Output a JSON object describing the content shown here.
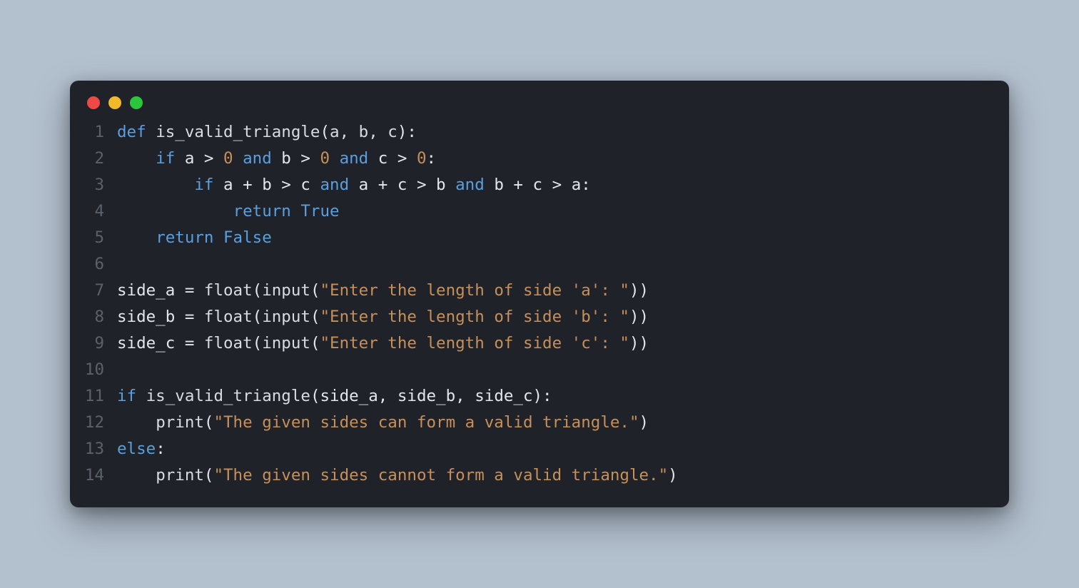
{
  "window": {
    "dots": {
      "red": "#ed4947",
      "yellow": "#f2b92c",
      "green": "#2bc63e"
    }
  },
  "code": {
    "lines": [
      {
        "n": "1",
        "tokens": [
          {
            "t": "def ",
            "c": "kw"
          },
          {
            "t": "is_valid_triangle",
            "c": "fn"
          },
          {
            "t": "(",
            "c": "op"
          },
          {
            "t": "a, b, c",
            "c": "param"
          },
          {
            "t": ")",
            "c": "op"
          },
          {
            "t": ":",
            "c": "op"
          }
        ]
      },
      {
        "n": "2",
        "tokens": [
          {
            "t": "    ",
            "c": "code"
          },
          {
            "t": "if ",
            "c": "kw"
          },
          {
            "t": "a ",
            "c": "id"
          },
          {
            "t": "> ",
            "c": "op"
          },
          {
            "t": "0",
            "c": "num"
          },
          {
            "t": " and ",
            "c": "kw"
          },
          {
            "t": "b ",
            "c": "id"
          },
          {
            "t": "> ",
            "c": "op"
          },
          {
            "t": "0",
            "c": "num"
          },
          {
            "t": " and ",
            "c": "kw"
          },
          {
            "t": "c ",
            "c": "id"
          },
          {
            "t": "> ",
            "c": "op"
          },
          {
            "t": "0",
            "c": "num"
          },
          {
            "t": ":",
            "c": "op"
          }
        ]
      },
      {
        "n": "3",
        "tokens": [
          {
            "t": "        ",
            "c": "code"
          },
          {
            "t": "if ",
            "c": "kw"
          },
          {
            "t": "a ",
            "c": "id"
          },
          {
            "t": "+ ",
            "c": "op"
          },
          {
            "t": "b ",
            "c": "id"
          },
          {
            "t": "> ",
            "c": "op"
          },
          {
            "t": "c ",
            "c": "id"
          },
          {
            "t": "and ",
            "c": "kw"
          },
          {
            "t": "a ",
            "c": "id"
          },
          {
            "t": "+ ",
            "c": "op"
          },
          {
            "t": "c ",
            "c": "id"
          },
          {
            "t": "> ",
            "c": "op"
          },
          {
            "t": "b ",
            "c": "id"
          },
          {
            "t": "and ",
            "c": "kw"
          },
          {
            "t": "b ",
            "c": "id"
          },
          {
            "t": "+ ",
            "c": "op"
          },
          {
            "t": "c ",
            "c": "id"
          },
          {
            "t": "> ",
            "c": "op"
          },
          {
            "t": "a",
            "c": "id"
          },
          {
            "t": ":",
            "c": "op"
          }
        ]
      },
      {
        "n": "4",
        "tokens": [
          {
            "t": "            ",
            "c": "code"
          },
          {
            "t": "return ",
            "c": "kw"
          },
          {
            "t": "True",
            "c": "bool"
          }
        ]
      },
      {
        "n": "5",
        "tokens": [
          {
            "t": "    ",
            "c": "code"
          },
          {
            "t": "return ",
            "c": "kw"
          },
          {
            "t": "False",
            "c": "bool"
          }
        ]
      },
      {
        "n": "6",
        "tokens": [
          {
            "t": "",
            "c": "code"
          }
        ]
      },
      {
        "n": "7",
        "tokens": [
          {
            "t": "side_a ",
            "c": "id"
          },
          {
            "t": "= ",
            "c": "op"
          },
          {
            "t": "float",
            "c": "call"
          },
          {
            "t": "(",
            "c": "op"
          },
          {
            "t": "input",
            "c": "call"
          },
          {
            "t": "(",
            "c": "op"
          },
          {
            "t": "\"Enter the length of side 'a': \"",
            "c": "str"
          },
          {
            "t": "))",
            "c": "op"
          }
        ]
      },
      {
        "n": "8",
        "tokens": [
          {
            "t": "side_b ",
            "c": "id"
          },
          {
            "t": "= ",
            "c": "op"
          },
          {
            "t": "float",
            "c": "call"
          },
          {
            "t": "(",
            "c": "op"
          },
          {
            "t": "input",
            "c": "call"
          },
          {
            "t": "(",
            "c": "op"
          },
          {
            "t": "\"Enter the length of side 'b': \"",
            "c": "str"
          },
          {
            "t": "))",
            "c": "op"
          }
        ]
      },
      {
        "n": "9",
        "tokens": [
          {
            "t": "side_c ",
            "c": "id"
          },
          {
            "t": "= ",
            "c": "op"
          },
          {
            "t": "float",
            "c": "call"
          },
          {
            "t": "(",
            "c": "op"
          },
          {
            "t": "input",
            "c": "call"
          },
          {
            "t": "(",
            "c": "op"
          },
          {
            "t": "\"Enter the length of side 'c': \"",
            "c": "str"
          },
          {
            "t": "))",
            "c": "op"
          }
        ]
      },
      {
        "n": "10",
        "tokens": [
          {
            "t": "",
            "c": "code"
          }
        ]
      },
      {
        "n": "11",
        "tokens": [
          {
            "t": "if ",
            "c": "kw"
          },
          {
            "t": "is_valid_triangle",
            "c": "call"
          },
          {
            "t": "(",
            "c": "op"
          },
          {
            "t": "side_a, side_b, side_c",
            "c": "id"
          },
          {
            "t": ")",
            "c": "op"
          },
          {
            "t": ":",
            "c": "op"
          }
        ]
      },
      {
        "n": "12",
        "tokens": [
          {
            "t": "    ",
            "c": "code"
          },
          {
            "t": "print",
            "c": "call"
          },
          {
            "t": "(",
            "c": "op"
          },
          {
            "t": "\"The given sides can form a valid triangle.\"",
            "c": "str"
          },
          {
            "t": ")",
            "c": "op"
          }
        ]
      },
      {
        "n": "13",
        "tokens": [
          {
            "t": "else",
            "c": "kw"
          },
          {
            "t": ":",
            "c": "op"
          }
        ]
      },
      {
        "n": "14",
        "tokens": [
          {
            "t": "    ",
            "c": "code"
          },
          {
            "t": "print",
            "c": "call"
          },
          {
            "t": "(",
            "c": "op"
          },
          {
            "t": "\"The given sides cannot form a valid triangle.\"",
            "c": "str"
          },
          {
            "t": ")",
            "c": "op"
          }
        ]
      }
    ]
  }
}
